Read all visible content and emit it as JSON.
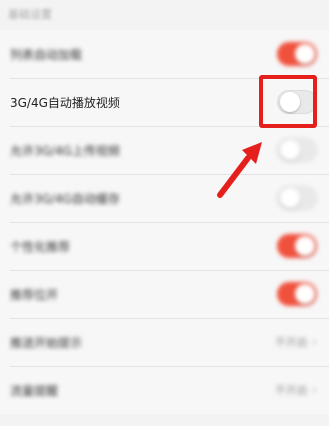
{
  "section_title": "基础设置",
  "settings": [
    {
      "label": "列表自动加载",
      "type": "toggle",
      "state": "on"
    },
    {
      "label": "3G/4G自动播放视频",
      "type": "toggle",
      "state": "off"
    },
    {
      "label": "允许3G/4G上传视频",
      "type": "toggle",
      "state": "off"
    },
    {
      "label": "允许3G/4G自动缓存",
      "type": "toggle",
      "state": "off"
    },
    {
      "label": "个性化推荐",
      "type": "toggle",
      "state": "on"
    },
    {
      "label": "推荐位开",
      "type": "toggle",
      "state": "on"
    },
    {
      "label": "推送开始提示",
      "type": "select",
      "value": "不开启"
    },
    {
      "label": "流量提醒",
      "type": "select",
      "value": "不开启"
    }
  ],
  "colors": {
    "accent": "#f0513d",
    "highlight": "#e5201c"
  },
  "icons": {
    "select_arrow": "chevron-right-icon",
    "callout": "arrow-icon"
  }
}
